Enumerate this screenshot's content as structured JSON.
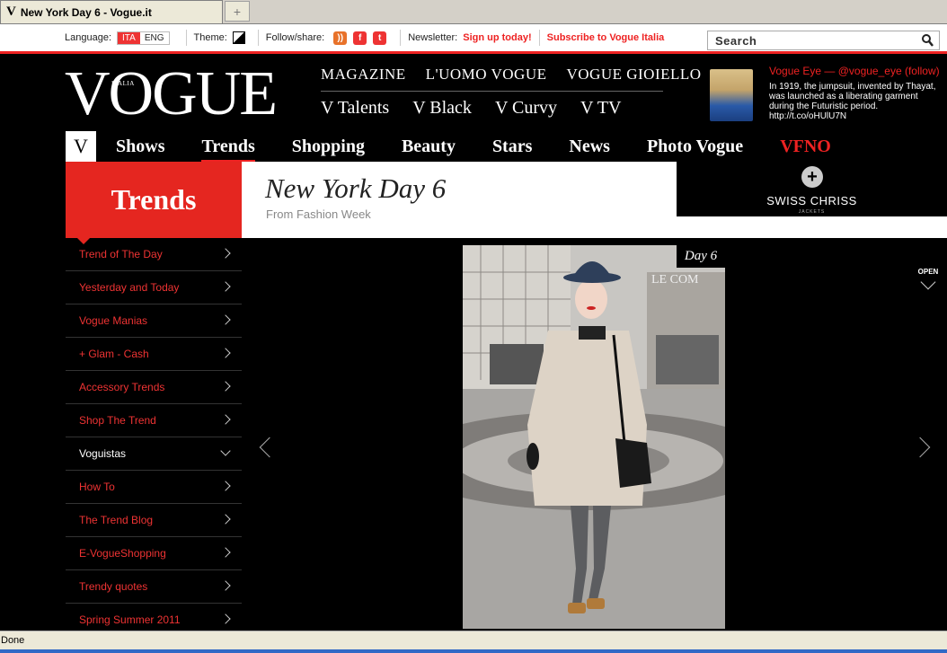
{
  "browser": {
    "tab_title": "New York Day 6 - Vogue.it",
    "favicon": "V",
    "new_tab": "+",
    "status": "Done"
  },
  "utility": {
    "language_label": "Language:",
    "lang_ita": "ITA",
    "lang_eng": "ENG",
    "theme_label": "Theme:",
    "follow_label": "Follow/share:",
    "newsletter_label": "Newsletter:",
    "signup": "Sign up today!",
    "subscribe": "Subscribe to Vogue Italia",
    "search_placeholder": "Search"
  },
  "header": {
    "logo": "VOGUE",
    "logo_sub": "ITALIA",
    "menu_top": [
      "MAGAZINE",
      "L'UOMO VOGUE",
      "VOGUE GIOIELLO"
    ],
    "menu_sub": [
      "V Talents",
      "V Black",
      "V Curvy",
      "V TV"
    ],
    "eye_title": "Vogue Eye — @vogue_eye (follow)",
    "eye_text": "In 1919, the jumpsuit, invented by Thayat, was launched as a liberating garment during the Futuristic period. http://t.co/oHUlU7N",
    "nav_v": "V",
    "nav": [
      "Shows",
      "Trends",
      "Shopping",
      "Beauty",
      "Stars",
      "News",
      "Photo Vogue",
      "VFNO"
    ]
  },
  "banner": {
    "section": "Trends",
    "title": "New York Day 6",
    "subtitle": "From Fashion Week",
    "ad_brand": "SWISS CHRISS",
    "ad_sub": "JACKETS"
  },
  "sidebar": {
    "items": [
      "Trend of The Day",
      "Yesterday and Today",
      "Vogue Manias",
      "+ Glam - Cash",
      "Accessory Trends",
      "Shop The Trend",
      "Voguistas",
      "How To",
      "The Trend Blog",
      "E-VogueShopping",
      "Trendy quotes",
      "Spring Summer 2011"
    ]
  },
  "gallery": {
    "day_label": "Day 6",
    "open_label": "OPEN",
    "photo_sign": "LE COM"
  },
  "colors": {
    "accent": "#e52620",
    "background": "#000000"
  }
}
